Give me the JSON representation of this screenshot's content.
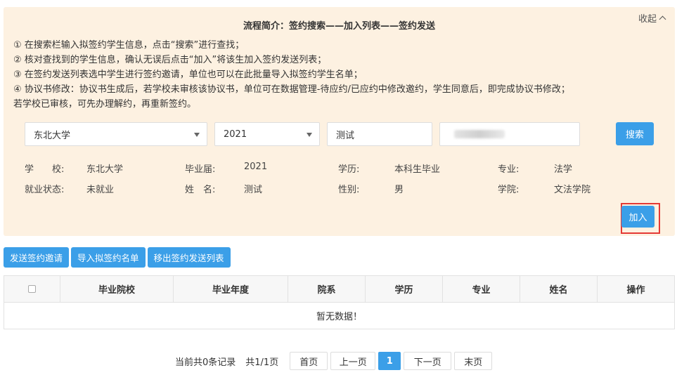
{
  "panel": {
    "title": "流程简介：签约搜索——加入列表——签约发送",
    "collapse_label": "收起",
    "steps": [
      "① 在搜索栏输入拟签约学生信息，点击“搜索”进行查找；",
      "② 核对查找到的学生信息，确认无误后点击“加入”将该生加入签约发送列表；",
      "③ 在签约发送列表选中学生进行签约邀请，单位也可以在此批量导入拟签约学生名单；",
      "④ 协议书修改：协议书生成后，若学校未审核该协议书，单位可在数据管理-待应约/已应约中修改邀约，学生同意后，即完成协议书修改；",
      "若学校已审核，可先办理解约，再重新签约。"
    ]
  },
  "search": {
    "school_value": "东北大学",
    "year_value": "2021",
    "name_value": "测试",
    "search_label": "搜索"
  },
  "student": {
    "school_key": "学　　校:",
    "school": "东北大学",
    "year_key": "毕业届:",
    "year": "2021",
    "edu_key": "学历:",
    "edu": "本科生毕业",
    "major_key": "专业:",
    "major": "法学",
    "status_key": "就业状态:",
    "status": "未就业",
    "name_key": "姓　名:",
    "name": "测试",
    "gender_key": "性别:",
    "gender": "男",
    "college_key": "学院:",
    "college": "文法学院",
    "add_label": "加入"
  },
  "toolbar": {
    "send_label": "发送签约邀请",
    "import_label": "导入拟签约名单",
    "remove_label": "移出签约发送列表"
  },
  "table": {
    "headers": [
      "毕业院校",
      "毕业年度",
      "院系",
      "学历",
      "专业",
      "姓名",
      "操作"
    ],
    "empty_text": "暂无数据！"
  },
  "pager": {
    "summary": "当前共0条记录",
    "total": "共1/1页",
    "first": "首页",
    "prev": "上一页",
    "current": "1",
    "next": "下一页",
    "last": "末页"
  },
  "colors": {
    "accent": "#3b9fe8",
    "panel_bg": "#fdf1e1",
    "highlight": "#e53935"
  }
}
